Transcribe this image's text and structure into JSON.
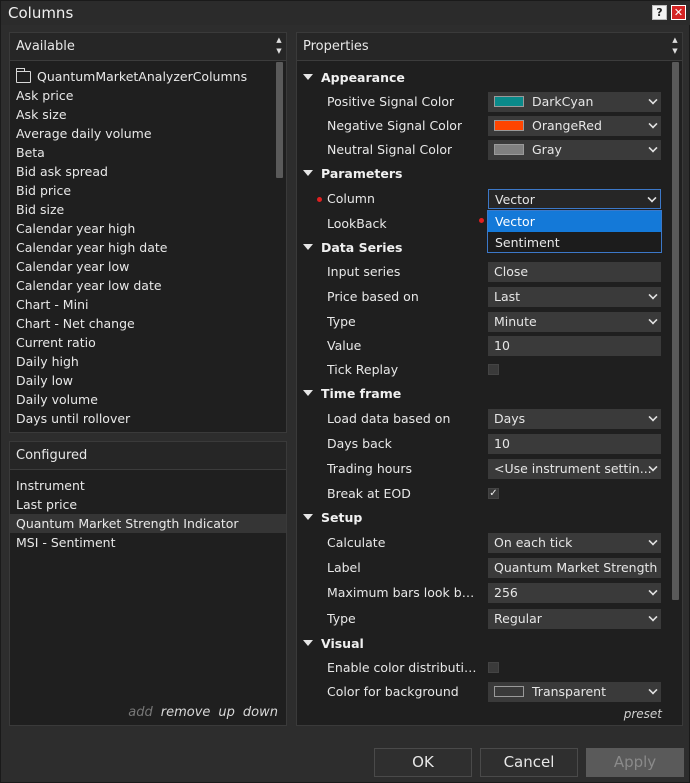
{
  "window": {
    "title": "Columns",
    "help_label": "?",
    "close_label": "✕"
  },
  "available": {
    "header": "Available",
    "folder": "QuantumMarketAnalyzerColumns",
    "items": [
      "Ask price",
      "Ask size",
      "Average daily volume",
      "Beta",
      "Bid ask spread",
      "Bid price",
      "Bid size",
      "Calendar year high",
      "Calendar year high date",
      "Calendar year low",
      "Calendar year low date",
      "Chart - Mini",
      "Chart - Net change",
      "Current ratio",
      "Daily high",
      "Daily low",
      "Daily volume",
      "Days until rollover"
    ]
  },
  "configured": {
    "header": "Configured",
    "items": [
      "Instrument",
      "Last price",
      "Quantum Market Strength Indicator",
      "MSI - Sentiment"
    ],
    "selected_index": 2,
    "links": {
      "add": "add",
      "remove": "remove",
      "up": "up",
      "down": "down"
    }
  },
  "properties": {
    "header": "Properties",
    "appearance": {
      "label": "Appearance",
      "positive_label": "Positive Signal Color",
      "positive_value": "DarkCyan",
      "positive_color": "#0a8a8a",
      "negative_label": "Negative Signal Color",
      "negative_value": "OrangeRed",
      "negative_color": "#ff4500",
      "neutral_label": "Neutral Signal Color",
      "neutral_value": "Gray",
      "neutral_color": "#808080"
    },
    "parameters": {
      "label": "Parameters",
      "column_label": "Column",
      "column_value": "Vector",
      "lookback_label": "LookBack",
      "dropdown_options": [
        "Vector",
        "Sentiment"
      ]
    },
    "data_series": {
      "label": "Data Series",
      "input_label": "Input series",
      "input_value": "Close",
      "price_label": "Price based on",
      "price_value": "Last",
      "type_label": "Type",
      "type_value": "Minute",
      "value_label": "Value",
      "value_value": "10",
      "tick_label": "Tick Replay",
      "tick_checked": false
    },
    "time_frame": {
      "label": "Time frame",
      "load_label": "Load data based on",
      "load_value": "Days",
      "days_label": "Days back",
      "days_value": "10",
      "hours_label": "Trading hours",
      "hours_value": "<Use instrument settin...",
      "eod_label": "Break at EOD",
      "eod_checked": true
    },
    "setup": {
      "label": "Setup",
      "calc_label": "Calculate",
      "calc_value": "On each tick",
      "lbl_label": "Label",
      "lbl_value": "Quantum Market Strength",
      "max_label": "Maximum bars look ba...",
      "max_value": "256",
      "type_label": "Type",
      "type_value": "Regular"
    },
    "visual": {
      "label": "Visual",
      "enable_label": "Enable color distribution",
      "enable_checked": false,
      "bg_label": "Color for background",
      "bg_value": "Transparent",
      "bg_color": "transparent"
    },
    "preset": "preset"
  },
  "buttons": {
    "ok": "OK",
    "cancel": "Cancel",
    "apply": "Apply"
  }
}
